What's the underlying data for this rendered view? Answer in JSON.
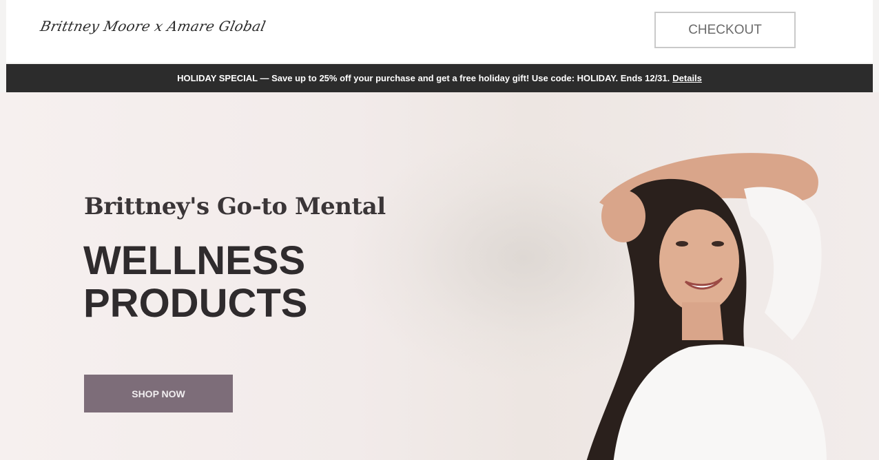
{
  "header": {
    "logo_text": "Brittney Moore x Amare Global",
    "checkout_label": "CHECKOUT"
  },
  "promo": {
    "text": "HOLIDAY SPECIAL — Save up to 25% off your purchase and get a free holiday gift! Use code: HOLIDAY. Ends 12/31.",
    "details_label": "Details"
  },
  "hero": {
    "subtitle": "Brittney's Go-to Mental",
    "title": "WELLNESS\nPRODUCTS",
    "cta_label": "SHOP NOW"
  },
  "colors": {
    "promo_bg": "#2c2c2c",
    "cta_bg": "#7d6d79",
    "hero_bg": "#f2ebea"
  }
}
